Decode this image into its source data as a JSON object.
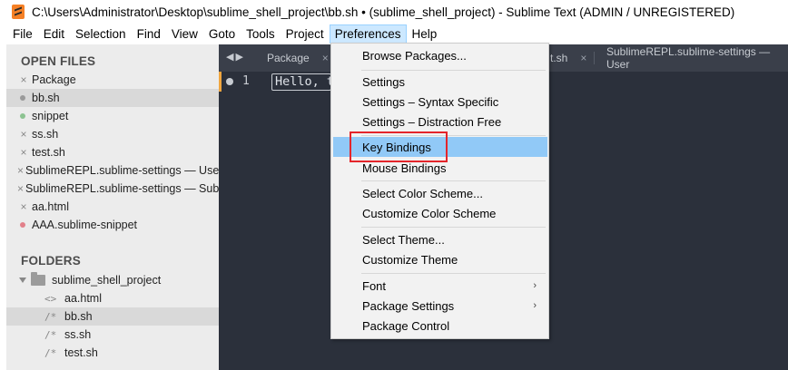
{
  "window": {
    "title": "C:\\Users\\Administrator\\Desktop\\sublime_shell_project\\bb.sh • (sublime_shell_project) - Sublime Text (ADMIN / UNREGISTERED)"
  },
  "menubar": [
    {
      "label": "File"
    },
    {
      "label": "Edit"
    },
    {
      "label": "Selection"
    },
    {
      "label": "Find"
    },
    {
      "label": "View"
    },
    {
      "label": "Goto"
    },
    {
      "label": "Tools"
    },
    {
      "label": "Project"
    },
    {
      "label": "Preferences",
      "active": true
    },
    {
      "label": "Help"
    }
  ],
  "sidebar": {
    "open_files_heading": "OPEN FILES",
    "open_files": [
      {
        "label": "Package",
        "mark": "close"
      },
      {
        "label": "bb.sh",
        "mark": "dot-gray",
        "selected": true
      },
      {
        "label": "snippet",
        "mark": "dot-green"
      },
      {
        "label": "ss.sh",
        "mark": "close"
      },
      {
        "label": "test.sh",
        "mark": "close"
      },
      {
        "label": "SublimeREPL.sublime-settings — User",
        "mark": "close"
      },
      {
        "label": "SublimeREPL.sublime-settings — Sublime",
        "mark": "close"
      },
      {
        "label": "aa.html",
        "mark": "close"
      },
      {
        "label": "AAA.sublime-snippet",
        "mark": "dot-red"
      }
    ],
    "folders_heading": "FOLDERS",
    "folder_name": "sublime_shell_project",
    "folder_files": [
      {
        "glyph": "<>",
        "label": "aa.html"
      },
      {
        "glyph": "/*",
        "label": "bb.sh",
        "selected": true
      },
      {
        "glyph": "/*",
        "label": "ss.sh"
      },
      {
        "glyph": "/*",
        "label": "test.sh"
      }
    ]
  },
  "editor": {
    "tabs": [
      {
        "label": "Package",
        "close": "×"
      },
      {
        "label": "t.sh",
        "close": "×"
      },
      {
        "label": "SublimeREPL.sublime-settings — User",
        "close": ""
      }
    ],
    "line_number": "1",
    "code_text": "Hello, t"
  },
  "preferences_menu": {
    "items": [
      {
        "label": "Browse Packages..."
      },
      {
        "label": "Settings"
      },
      {
        "label": "Settings – Syntax Specific"
      },
      {
        "label": "Settings – Distraction Free"
      },
      {
        "label": "Key Bindings",
        "highlighted": true
      },
      {
        "label": "Mouse Bindings"
      },
      {
        "label": "Select Color Scheme..."
      },
      {
        "label": "Customize Color Scheme"
      },
      {
        "label": "Select Theme..."
      },
      {
        "label": "Customize Theme"
      },
      {
        "label": "Font",
        "submenu": "›"
      },
      {
        "label": "Package Settings",
        "submenu": "›"
      },
      {
        "label": "Package Control"
      }
    ]
  },
  "colors": {
    "editor_bg": "#2b303b",
    "highlight": "#91c9f7",
    "annotation_box": "#e4252b",
    "gutter_marker": "#f0a640"
  }
}
